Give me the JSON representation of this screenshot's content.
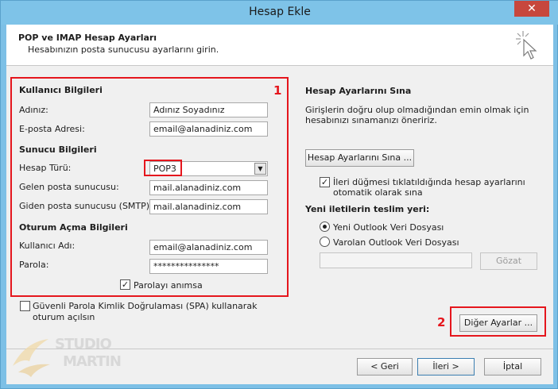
{
  "window": {
    "title": "Hesap Ekle",
    "close_glyph": "✕"
  },
  "header": {
    "title": "POP ve IMAP Hesap Ayarları",
    "subtitle": "Hesabınızın posta sunucusu ayarlarını girin.",
    "icon": "cursor-sparkle-icon"
  },
  "left": {
    "user_section": "Kullanıcı Bilgileri",
    "name_label": "Adınız:",
    "name_value": "Adınız Soyadınız",
    "email_label": "E-posta Adresi:",
    "email_value": "email@alanadiniz.com",
    "server_section": "Sunucu Bilgileri",
    "account_type_label": "Hesap Türü:",
    "account_type_value": "POP3",
    "incoming_label": "Gelen posta sunucusu:",
    "incoming_value": "mail.alanadiniz.com",
    "outgoing_label": "Giden posta sunucusu (SMTP):",
    "outgoing_value": "mail.alanadiniz.com",
    "logon_section": "Oturum Açma Bilgileri",
    "username_label": "Kullanıcı Adı:",
    "username_value": "email@alanadiniz.com",
    "password_label": "Parola:",
    "password_value": "***************",
    "remember_label": "Parolayı anımsa",
    "spa_label_1": "Güvenli Parola Kimlik Doğrulaması (SPA) kullanarak",
    "spa_label_2": "oturum açılsın"
  },
  "right": {
    "test_section": "Hesap Ayarlarını Sına",
    "test_desc_1": "Girişlerin doğru olup olmadığından emin olmak için",
    "test_desc_2": "hesabınızı sınamanızı öneririz.",
    "test_button": "Hesap Ayarlarını Sına ...",
    "auto_test_1": "İleri düğmesi tıklatıldığında hesap ayarlarını",
    "auto_test_2": "otomatik olarak sına",
    "deliver_label": "Yeni iletilerin teslim yeri:",
    "radio_new": "Yeni Outlook Veri Dosyası",
    "radio_existing": "Varolan Outlook Veri Dosyası",
    "browse_button": "Gözat",
    "more_settings_button": "Diğer Ayarlar ..."
  },
  "annotations": {
    "num_1": "1",
    "num_2": "2",
    "color": "#e5161d"
  },
  "footer": {
    "back_button": "< Geri",
    "next_button": "İleri >",
    "cancel_button": "İptal"
  },
  "watermark": {
    "line1": "STUDIO",
    "line2": "MARTIN"
  }
}
